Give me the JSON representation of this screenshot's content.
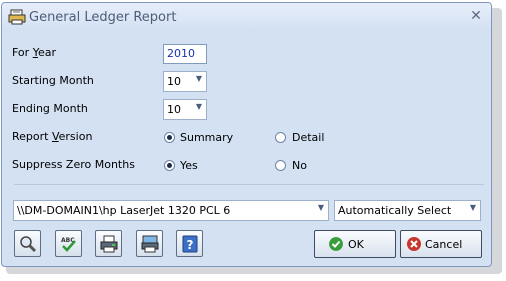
{
  "window": {
    "title": "General Ledger Report",
    "close_glyph": "✕"
  },
  "form": {
    "year": {
      "label_pre": "For ",
      "label_ul": "Y",
      "label_post": "ear",
      "value": "2010"
    },
    "starting_month": {
      "label": "Starting Month",
      "value": "10"
    },
    "ending_month": {
      "label": "Ending Month",
      "value": "10"
    },
    "report_version": {
      "label_pre": "Report ",
      "label_ul": "V",
      "label_post": "ersion",
      "options": [
        "Summary",
        "Detail"
      ],
      "selected": "Summary"
    },
    "suppress_zero_months": {
      "label": "Suppress Zero Months",
      "options": [
        "Yes",
        "No"
      ],
      "selected": "Yes"
    }
  },
  "printer": {
    "value": "\\\\DM-DOMAIN1\\hp LaserJet 1320 PCL 6"
  },
  "tray": {
    "value": "Automatically Select"
  },
  "toolbar": {
    "icons": [
      "magnifier-icon",
      "spellcheck-icon",
      "printer-setup-icon",
      "print-preview-icon",
      "help-icon"
    ]
  },
  "buttons": {
    "ok": "OK",
    "cancel": "Cancel"
  },
  "colors": {
    "window_bg": "#d3e1f3",
    "ok_green": "#3a9c3a",
    "cancel_red": "#c8372d",
    "value_blue": "#1533ad"
  }
}
